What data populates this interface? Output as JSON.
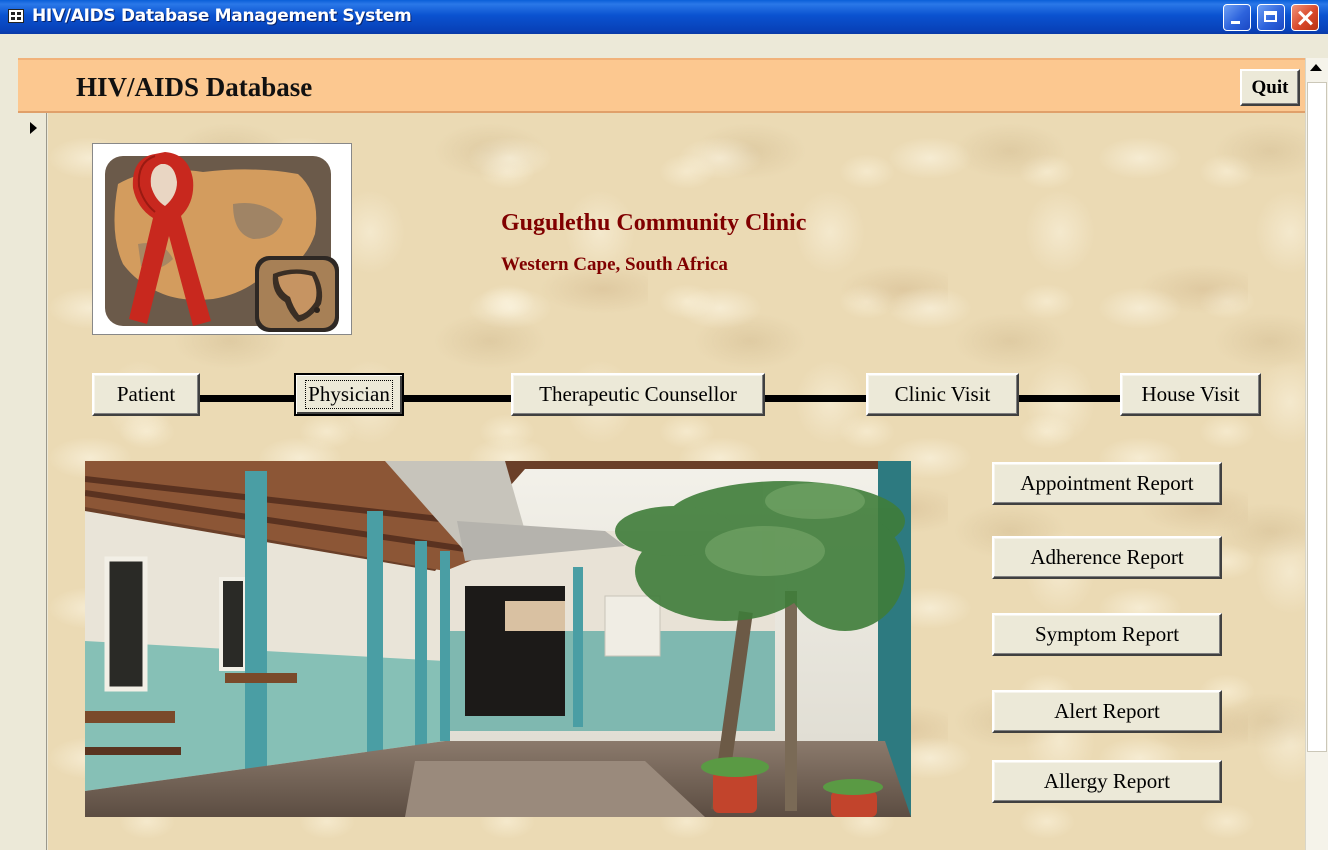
{
  "window": {
    "title": "HIV/AIDS Database Management System"
  },
  "header": {
    "title": "HIV/AIDS Database",
    "quit_label": "Quit"
  },
  "clinic": {
    "name": "Gugulethu Community Clinic",
    "location": "Western Cape, South Africa"
  },
  "nav_buttons": {
    "patient": "Patient",
    "physician": "Physician",
    "counsellor": "Therapeutic Counsellor",
    "clinic_visit": "Clinic Visit",
    "house_visit": "House Visit"
  },
  "reports": {
    "appointment": "Appointment Report",
    "adherence": "Adherence Report",
    "symptom": "Symptom Report",
    "alert": "Alert Report",
    "allergy": "Allergy Report"
  },
  "state": {
    "focused_button": "Physician"
  },
  "colors": {
    "titlebar": "#0a52d0",
    "header_band": "#fcc890",
    "clinic_text": "#800000",
    "ribbon": "#c8281e"
  },
  "icons": {
    "app": "form-icon",
    "minimize": "minimize-icon",
    "maximize": "maximize-icon",
    "close": "close-icon",
    "record_selector": "record-pointer-icon",
    "scroll_up": "scroll-up-icon"
  }
}
